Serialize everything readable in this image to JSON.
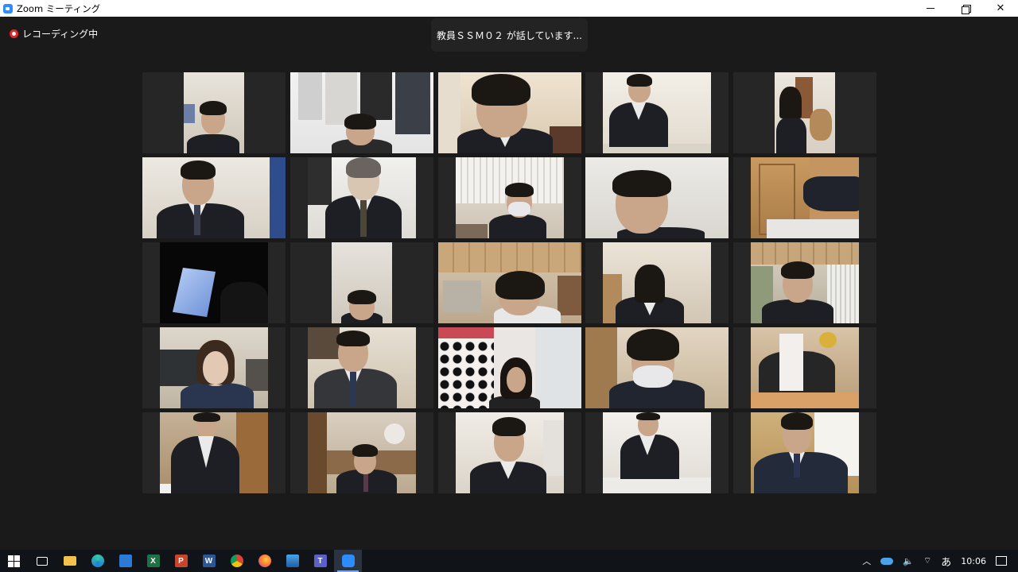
{
  "window": {
    "title": "Zoom ミーティング",
    "controls": [
      "minimize",
      "restore",
      "close"
    ]
  },
  "meeting": {
    "recording_label": "レコーディング中",
    "speaker_banner": "教員ＳＳＭ０２ が話しています..."
  },
  "taskbar": {
    "apps": [
      {
        "name": "task-view",
        "icon": "task-view-icon"
      },
      {
        "name": "file-explorer",
        "icon": "folder-icon"
      },
      {
        "name": "edge",
        "icon": "edge-icon"
      },
      {
        "name": "store",
        "icon": "store-icon"
      },
      {
        "name": "excel",
        "icon": "excel-icon",
        "glyph": "X"
      },
      {
        "name": "powerpoint",
        "icon": "powerpoint-icon",
        "glyph": "P"
      },
      {
        "name": "word",
        "icon": "word-icon",
        "glyph": "W"
      },
      {
        "name": "chrome",
        "icon": "chrome-icon"
      },
      {
        "name": "firefox",
        "icon": "firefox-icon"
      },
      {
        "name": "photos",
        "icon": "photos-icon"
      },
      {
        "name": "teams",
        "icon": "teams-icon",
        "glyph": "T"
      },
      {
        "name": "zoom",
        "icon": "zoom-icon",
        "active": true
      }
    ],
    "tray": {
      "ime": "あ",
      "clock": "10:06"
    }
  },
  "colors": {
    "background": "#1a1a1a",
    "tile": "#262626",
    "recording_red": "#e02828",
    "zoom_blue": "#2d8cff",
    "taskbar": "#101419"
  }
}
